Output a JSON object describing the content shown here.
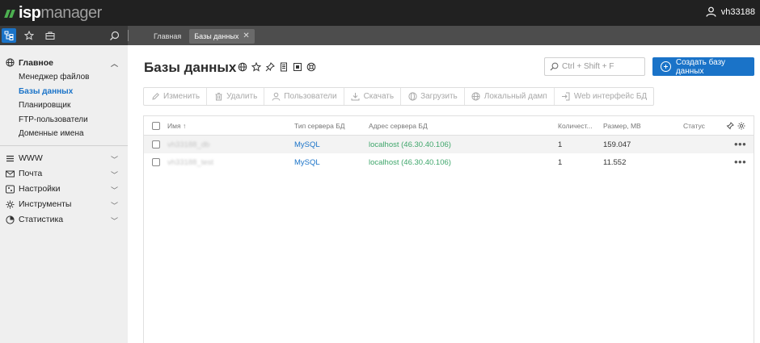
{
  "app": {
    "logo_brand": "isp",
    "logo_product": "manager",
    "user_name": "vh33188"
  },
  "breadcrumbs": [
    {
      "label": "Главная"
    },
    {
      "label": "Базы данных"
    }
  ],
  "sidebar": {
    "groups": [
      {
        "label": "Главное",
        "icon": "globe-icon",
        "expanded": true,
        "items": [
          {
            "label": "Менеджер файлов"
          },
          {
            "label": "Базы данных",
            "active": true
          },
          {
            "label": "Планировщик"
          },
          {
            "label": "FTP-пользователи"
          },
          {
            "label": "Доменные имена"
          }
        ]
      },
      {
        "label": "WWW",
        "icon": "www-icon"
      },
      {
        "label": "Почта",
        "icon": "mail-icon"
      },
      {
        "label": "Настройки",
        "icon": "settings-icon"
      },
      {
        "label": "Инструменты",
        "icon": "tools-icon"
      },
      {
        "label": "Статистика",
        "icon": "pie-chart-icon"
      }
    ]
  },
  "main": {
    "title": "Базы данных",
    "search_placeholder": "Ctrl + Shift + F",
    "create_label": "Создать базу данных",
    "toolbar": [
      {
        "label": "Изменить",
        "icon": "edit-icon"
      },
      {
        "label": "Удалить",
        "icon": "trash-icon"
      },
      {
        "label": "Пользователи",
        "icon": "user-icon"
      },
      {
        "label": "Скачать",
        "icon": "download-icon"
      },
      {
        "label": "Загрузить",
        "icon": "upload-icon"
      },
      {
        "label": "Локальный дамп",
        "icon": "dump-icon"
      },
      {
        "label": "Web интерфейс БД",
        "icon": "login-icon"
      }
    ],
    "table": {
      "columns": {
        "name": "Имя",
        "sort_arrow": "↑",
        "type": "Тип сервера БД",
        "address": "Адрес сервера БД",
        "count": "Количест...",
        "size": "Размер, MB",
        "status": "Статус"
      },
      "rows": [
        {
          "name": "vh33188_db",
          "type": "MySQL",
          "address": "localhost (46.30.40.106)",
          "count": "1",
          "size": "159.047"
        },
        {
          "name": "vh33188_test",
          "type": "MySQL",
          "address": "localhost (46.30.40.106)",
          "count": "1",
          "size": "11.552"
        }
      ],
      "row_menu": "•••"
    }
  },
  "colors": {
    "accent": "#1a73c8",
    "link_green": "#3fa66b",
    "topbar": "#212121",
    "sidebar_bg": "#efefef"
  }
}
